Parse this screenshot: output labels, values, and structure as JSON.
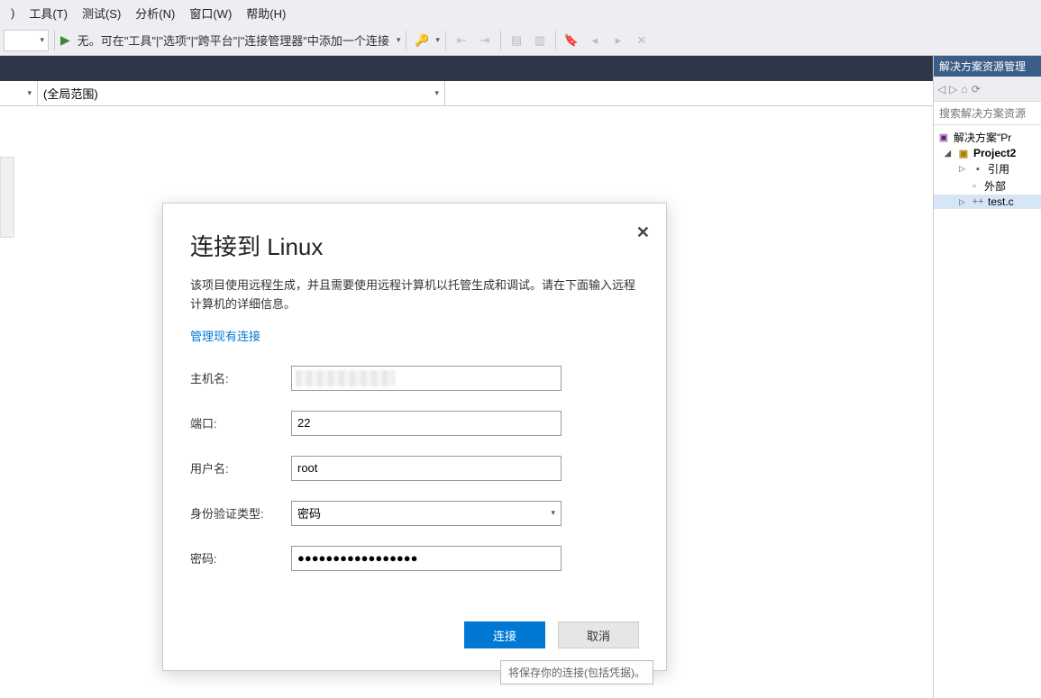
{
  "menu": {
    "items": [
      "工具(T)",
      "测试(S)",
      "分析(N)",
      "窗口(W)",
      "帮助(H)"
    ],
    "item0_partial": ")"
  },
  "toolbar": {
    "target_text": "无。可在\"工具\"|\"选项\"|\"跨平台\"|\"连接管理器\"中添加一个连接"
  },
  "scope": {
    "global": "(全局范围)"
  },
  "rightpanel": {
    "title": "解决方案资源管理",
    "search_placeholder": "搜索解决方案资源",
    "tree": {
      "solution": "解决方案\"Pr",
      "project": "Project2",
      "references": "引用",
      "external": "外部",
      "file": "test.c"
    }
  },
  "dialog": {
    "title": "连接到 Linux",
    "desc": "该项目使用远程生成，并且需要使用远程计算机以托管生成和调试。请在下面输入远程计算机的详细信息。",
    "manage_link": "管理现有连接",
    "labels": {
      "host": "主机名:",
      "port": "端口:",
      "user": "用户名:",
      "auth": "身份验证类型:",
      "password": "密码:"
    },
    "values": {
      "port": "22",
      "user": "root",
      "auth": "密码",
      "password_dots": "●●●●●●●●●●●●●●●●●"
    },
    "buttons": {
      "connect": "连接",
      "cancel": "取消"
    }
  },
  "tooltip": "将保存你的连接(包括凭据)。"
}
